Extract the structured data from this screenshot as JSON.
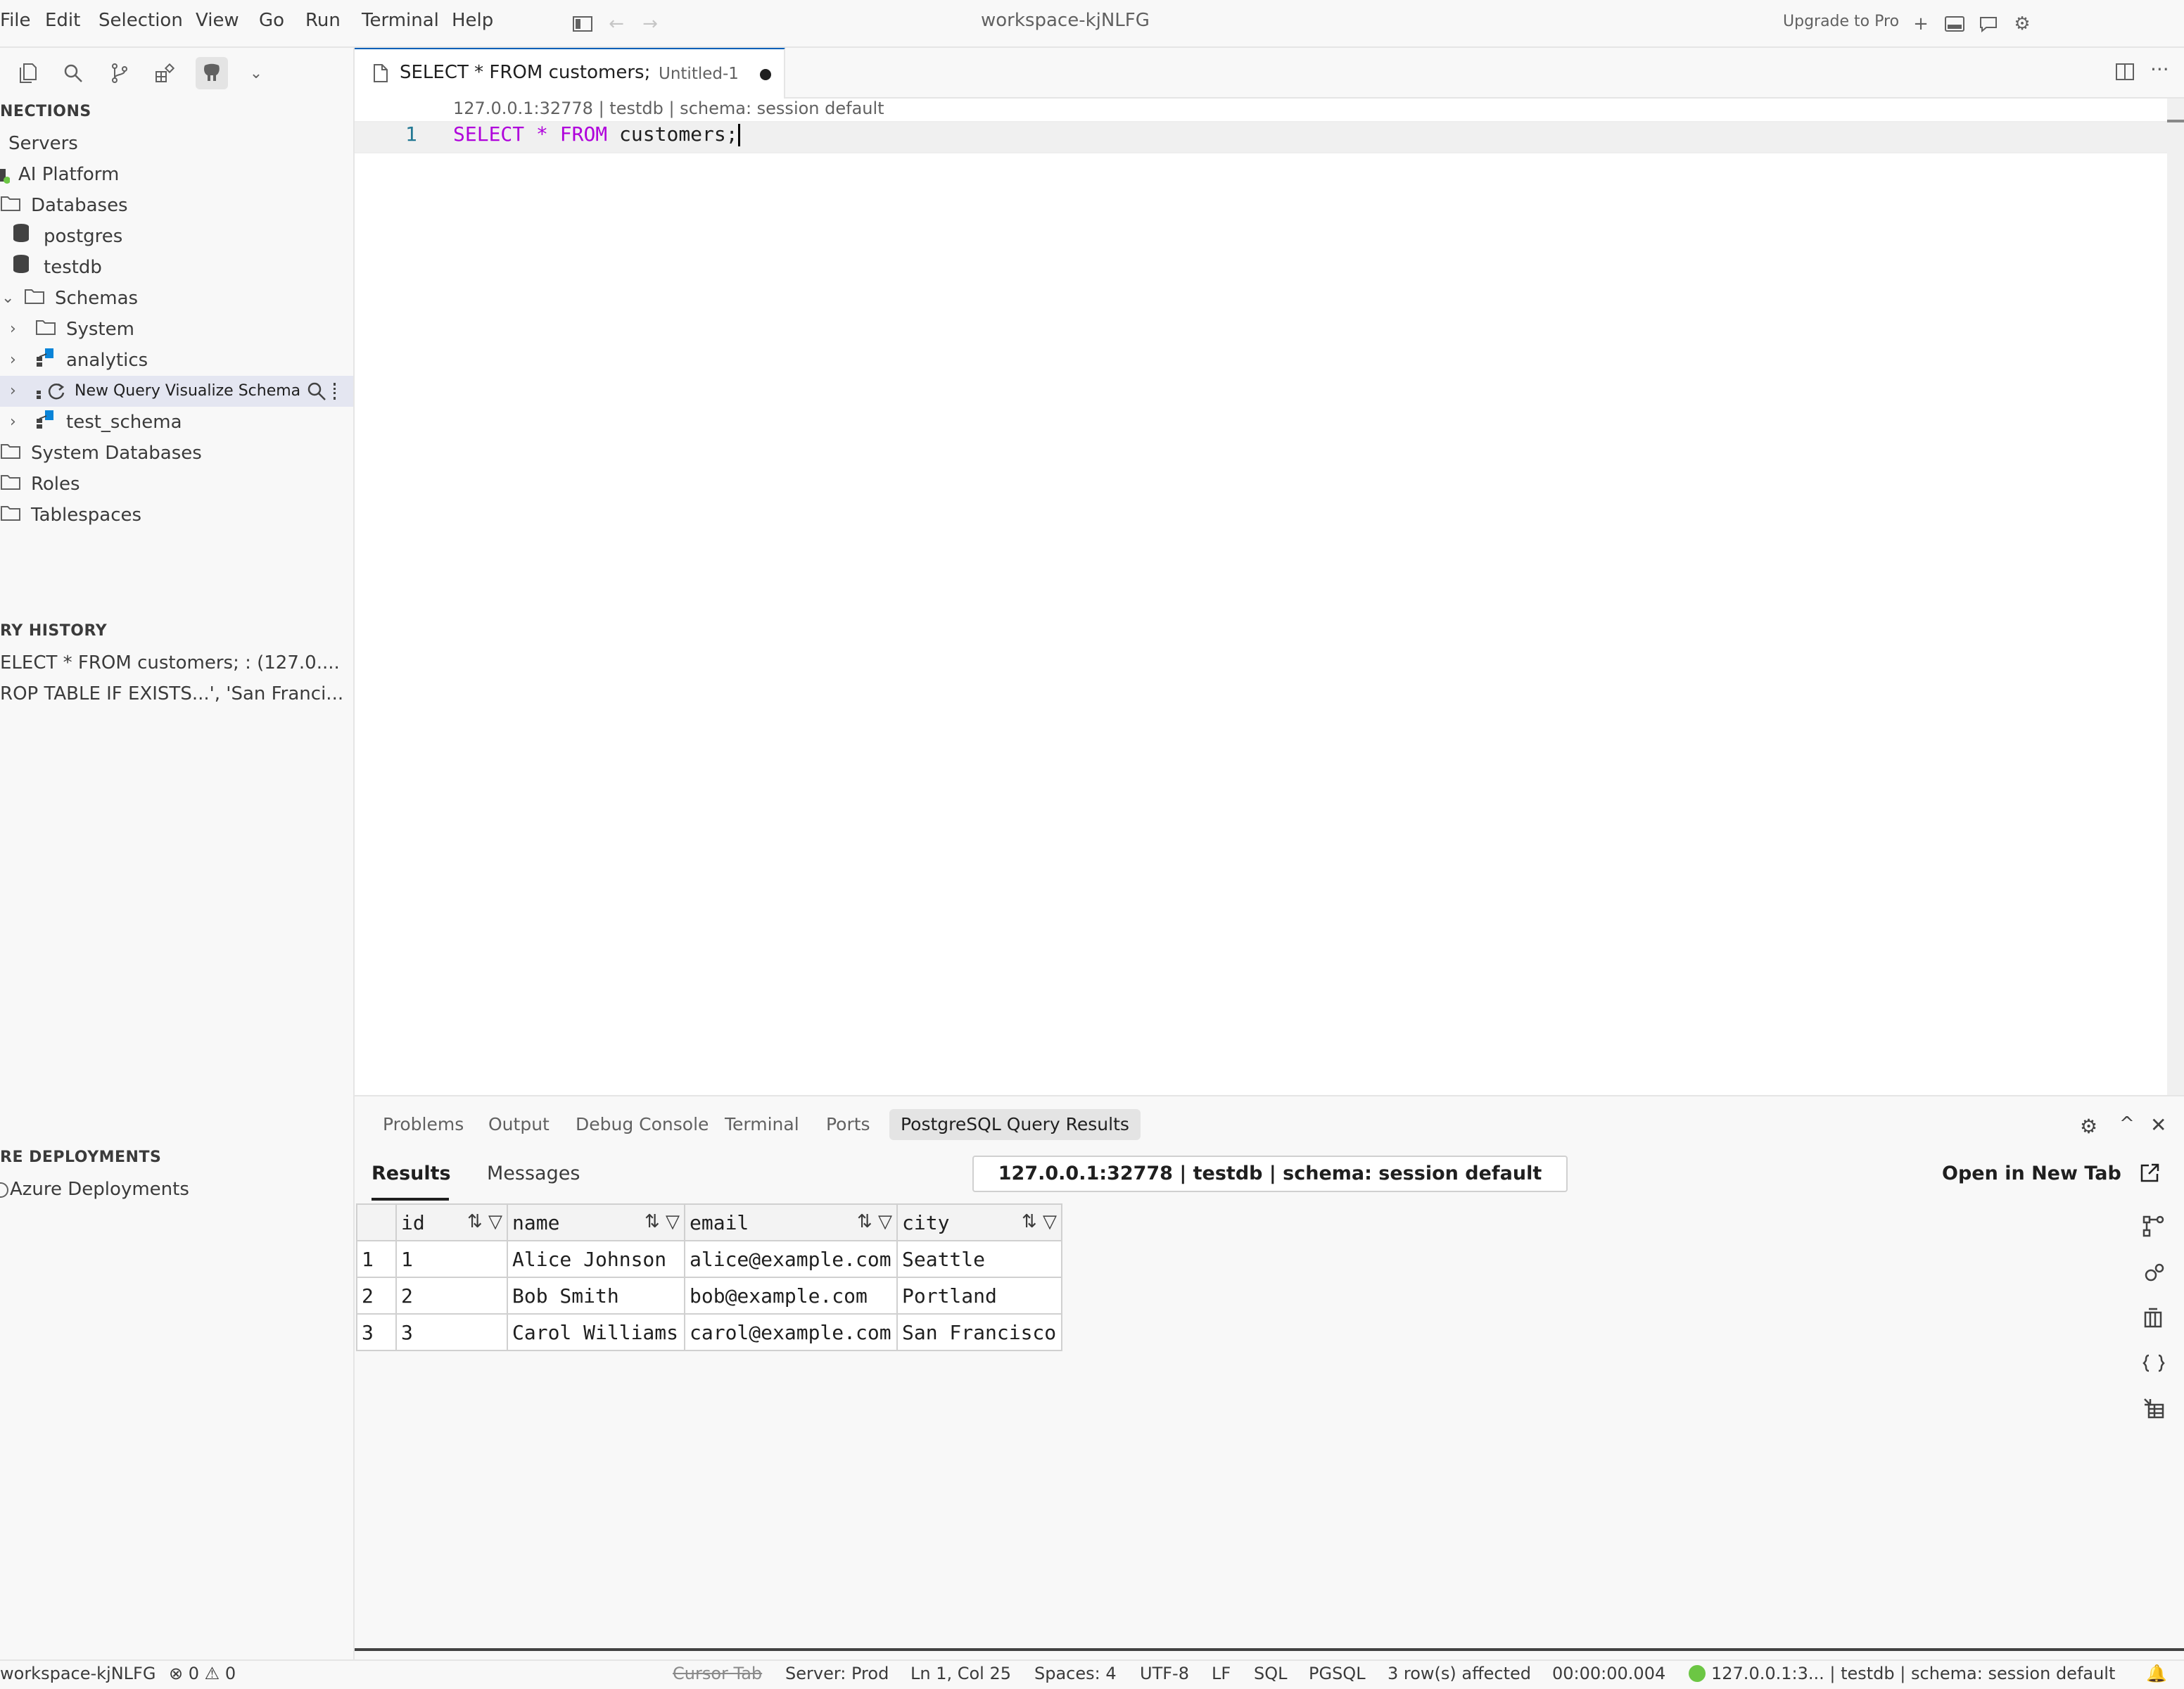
{
  "titlebar": {
    "menus": [
      "File",
      "Edit",
      "Selection",
      "View",
      "Go",
      "Run",
      "Terminal",
      "Help"
    ],
    "window_title": "workspace-kjNLFG",
    "upgrade_label": "Upgrade to Pro"
  },
  "sidebar": {
    "connections_header": "NECTIONS",
    "tree": {
      "servers": "Servers",
      "server": "AI Platform",
      "databases": "Databases",
      "db_postgres": "postgres",
      "db_testdb": "testdb",
      "schemas": "Schemas",
      "schema_system": "System",
      "schema_analytics": "analytics",
      "hover_row_actions": "New Query Visualize Schema",
      "schema_test": "test_schema",
      "system_databases": "System Databases",
      "roles": "Roles",
      "tablespaces": "Tablespaces"
    },
    "history_header": "RY HISTORY",
    "history_items": [
      "ELECT * FROM customers; : (127.0....",
      "ROP TABLE IF EXISTS...', 'San Franci..."
    ],
    "deploy_header": "RE DEPLOYMENTS",
    "deploy_item": "Azure Deployments"
  },
  "editor": {
    "tab_title": "SELECT * FROM customers;",
    "tab_subtitle": "Untitled-1",
    "codelens": "127.0.0.1:32778 | testdb | schema: session default",
    "line_number": "1",
    "code": {
      "kw1": "SELECT",
      "star": "*",
      "kw2": "FROM",
      "ident": "customers;"
    }
  },
  "panel": {
    "tabs": [
      "Problems",
      "Output",
      "Debug Console",
      "Terminal",
      "Ports",
      "PostgreSQL Query Results"
    ],
    "subtabs": {
      "results": "Results",
      "messages": "Messages"
    },
    "connection_info": "127.0.0.1:32778 | testdb | schema: session default",
    "open_new_tab": "Open in New Tab",
    "columns": [
      "id",
      "name",
      "email",
      "city"
    ],
    "rows": [
      {
        "n": "1",
        "id": "1",
        "name": "Alice Johnson",
        "email": "alice@example.com",
        "city": "Seattle"
      },
      {
        "n": "2",
        "id": "2",
        "name": "Bob Smith",
        "email": "bob@example.com",
        "city": "Portland"
      },
      {
        "n": "3",
        "id": "3",
        "name": "Carol Williams",
        "email": "carol@example.com",
        "city": "San Francisco"
      }
    ]
  },
  "statusbar": {
    "workspace": "workspace-kjNLFG",
    "errors": "0",
    "warnings": "0",
    "cursor_tab": "Cursor Tab",
    "server": "Server: Prod",
    "position": "Ln 1, Col 25",
    "spaces": "Spaces: 4",
    "encoding": "UTF-8",
    "eol": "LF",
    "lang": "SQL",
    "dialect": "PGSQL",
    "rows_affected": "3 row(s) affected",
    "duration": "00:00:00.004",
    "connection": "127.0.0.1:3... | testdb | schema: session default"
  },
  "colors": {
    "accent": "#005fb8",
    "keyword": "#af00db",
    "connected": "#6cc644"
  }
}
